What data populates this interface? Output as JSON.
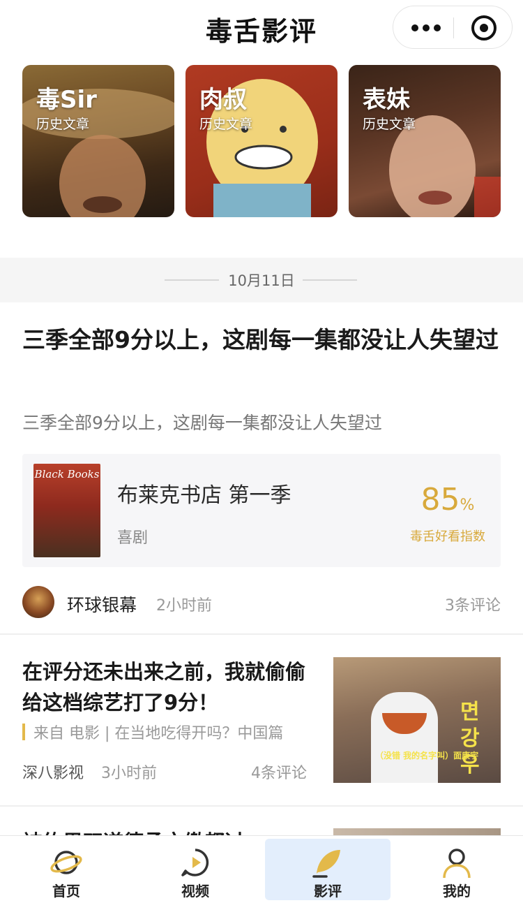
{
  "header": {
    "title": "毒舌影评"
  },
  "authors": [
    {
      "name": "毒Sir",
      "subtitle": "历史文章"
    },
    {
      "name": "肉叔",
      "subtitle": "历史文章"
    },
    {
      "name": "表妹",
      "subtitle": "历史文章"
    }
  ],
  "feed": {
    "date": "10月11日",
    "article1": {
      "title": "三季全部9分以上，这剧每一集都没让人失望过",
      "summary": "三季全部9分以上，这剧每一集都没让人失望过",
      "movie": {
        "poster_text": "Black Books",
        "title": "布莱克书店 第一季",
        "genre": "喜剧",
        "score": "85",
        "score_unit": "%",
        "score_label": "毒舌好看指数"
      },
      "source": "环球银幕",
      "time": "2小时前",
      "comments": "3条评论"
    },
    "article2": {
      "title": "在评分还未出来之前，我就偷偷给这档综艺打了9分！",
      "from": "来自 电影 | 在当地吃得开吗？中国篇",
      "source": "深八影视",
      "time": "3小时前",
      "comments": "4条评论",
      "thumb_caption": "（没错 我的名字叫）面康宇",
      "thumb_big": "면강우"
    },
    "article3": {
      "title": "被约男双道德承文缴都过"
    }
  },
  "tabs": [
    {
      "label": "首页",
      "icon": "planet-icon"
    },
    {
      "label": "视频",
      "icon": "play-icon"
    },
    {
      "label": "影评",
      "icon": "leaf-icon",
      "active": true
    },
    {
      "label": "我的",
      "icon": "user-icon"
    }
  ],
  "colors": {
    "accent": "#d8a93c",
    "tab_active_bg": "#e3eefc"
  }
}
